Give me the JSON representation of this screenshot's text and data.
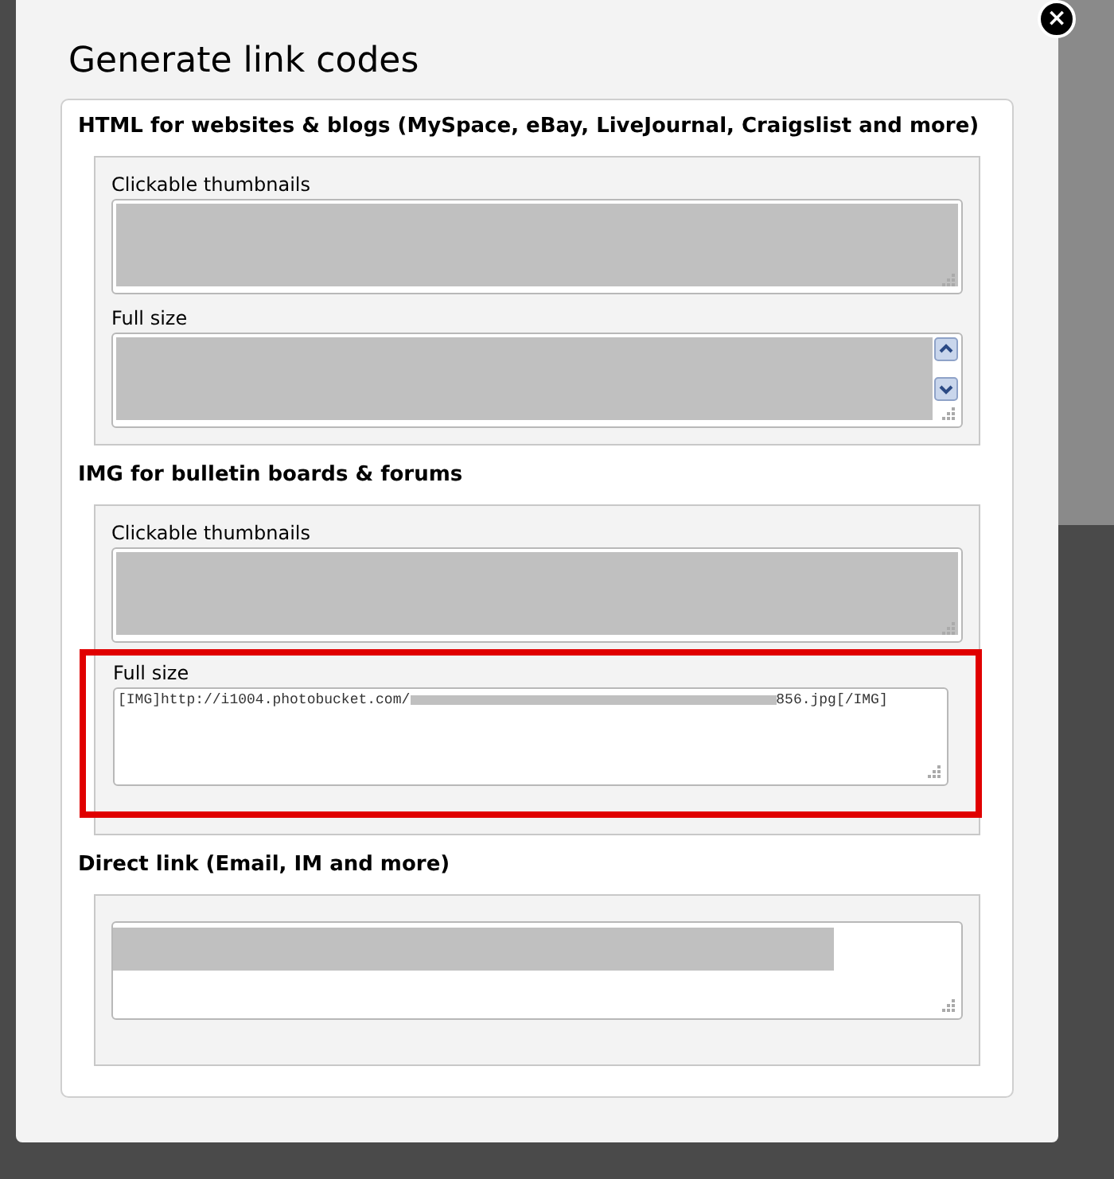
{
  "dialog": {
    "title": "Generate link codes",
    "close_icon": "×"
  },
  "sections": [
    {
      "heading": "HTML for websites & blogs (MySpace, eBay, LiveJournal, Craigslist and more)",
      "fields": [
        {
          "label": "Clickable thumbnails",
          "kind": "redacted",
          "highlighted": false,
          "scrollbar": false
        },
        {
          "label": "Full size",
          "kind": "redacted",
          "highlighted": false,
          "scrollbar": true
        }
      ]
    },
    {
      "heading": "IMG for bulletin boards & forums",
      "fields": [
        {
          "label": "Clickable thumbnails",
          "kind": "redacted",
          "highlighted": false,
          "scrollbar": false
        },
        {
          "label": "Full size",
          "kind": "partial",
          "value_start": "[IMG]http://i1004.photobucket.com/",
          "value_end": "856.jpg[/IMG]",
          "highlighted": true,
          "scrollbar": false
        }
      ]
    },
    {
      "heading": "Direct link (Email, IM and more)",
      "fields": [
        {
          "kind": "redacted_line",
          "highlighted": false,
          "scrollbar": false
        }
      ]
    }
  ]
}
